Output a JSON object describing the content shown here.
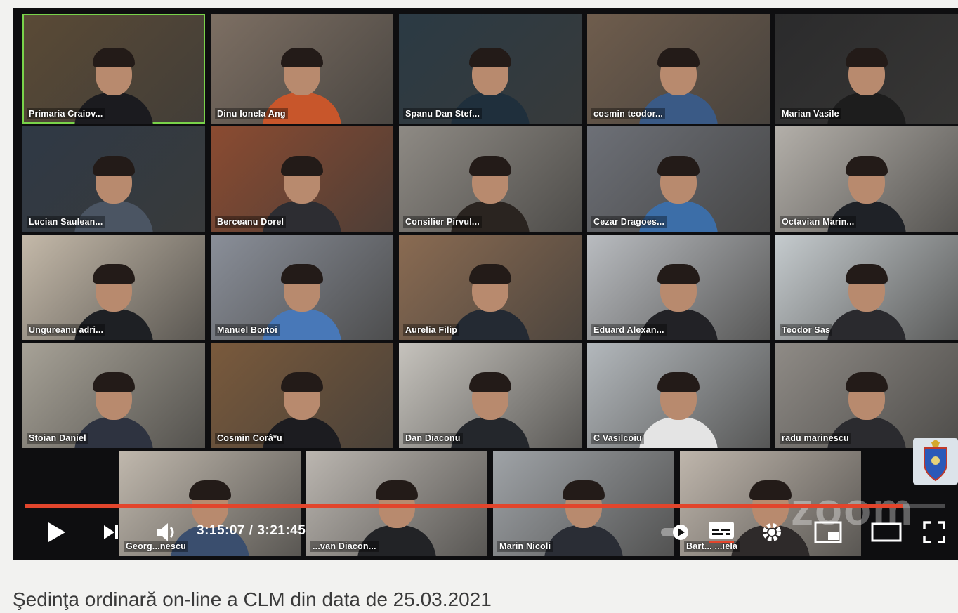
{
  "player": {
    "time_display": "3:15:07 / 3:21:45",
    "progress_fraction": 0.954,
    "watermark": "zoom",
    "accent_color": "#e2452c",
    "active_speaker_color": "#79d34a"
  },
  "participants": [
    {
      "name": "Primaria Craiov...",
      "active": true,
      "bg": "#5a4a36",
      "shirt": "#1b1b1f"
    },
    {
      "name": "Dinu Ionela Ang",
      "active": false,
      "bg": "#7d6f63",
      "shirt": "#c8562b"
    },
    {
      "name": "Spanu Dan Stef...",
      "active": false,
      "bg": "#2b3a44",
      "shirt": "#1f2f3c"
    },
    {
      "name": "cosmin teodor...",
      "active": false,
      "bg": "#6f5d4d",
      "shirt": "#3a5a86"
    },
    {
      "name": "Marian Vasile",
      "active": false,
      "bg": "#2b2b2c",
      "shirt": "#1d1d1d"
    },
    {
      "name": "Lucian Saulean...",
      "active": false,
      "bg": "#2f3945",
      "shirt": "#4b5563"
    },
    {
      "name": "Berceanu Dorel",
      "active": false,
      "bg": "#8b4b31",
      "shirt": "#2d2d32"
    },
    {
      "name": "Consilier Pirvul...",
      "active": false,
      "bg": "#8e8a84",
      "shirt": "#2a2420"
    },
    {
      "name": "Cezar Dragoes...",
      "active": false,
      "bg": "#6d7077",
      "shirt": "#3c6ea8"
    },
    {
      "name": "Octavian Marin...",
      "active": false,
      "bg": "#b3afa9",
      "shirt": "#1f2227"
    },
    {
      "name": "Ungureanu adri...",
      "active": false,
      "bg": "#c4b9a9",
      "shirt": "#1e2024"
    },
    {
      "name": "Manuel Bortoi",
      "active": false,
      "bg": "#8a8f99",
      "shirt": "#4878b8"
    },
    {
      "name": "Aurelia Filip",
      "active": false,
      "bg": "#8a6b52",
      "shirt": "#242a33"
    },
    {
      "name": "Eduard Alexan...",
      "active": false,
      "bg": "#b9bcc0",
      "shirt": "#222226"
    },
    {
      "name": "Teodor Sas",
      "active": false,
      "bg": "#c5cbce",
      "shirt": "#2a2a2e"
    },
    {
      "name": "Stoian Daniel",
      "active": false,
      "bg": "#a7a297",
      "shirt": "#2e3340"
    },
    {
      "name": "Cosmin Corâ*u",
      "active": false,
      "bg": "#7a5a3c",
      "shirt": "#1c1c20"
    },
    {
      "name": "Dan Diaconu",
      "active": false,
      "bg": "#c6c3bd",
      "shirt": "#24272c"
    },
    {
      "name": "C Vasilcoiu",
      "active": false,
      "bg": "#b3b8bc",
      "shirt": "#e4e4e4"
    },
    {
      "name": "radu marinescu",
      "active": false,
      "bg": "#8f8b86",
      "shirt": "#2b2b2f"
    },
    {
      "name": "Georg...nescu",
      "active": false,
      "bg": "#c0b8ad",
      "shirt": "#3a4e6e"
    },
    {
      "name": "...van Diacon...",
      "active": false,
      "bg": "#bbb6b0",
      "shirt": "#222326"
    },
    {
      "name": "Marin Nicoli",
      "active": false,
      "bg": "#9fa3a7",
      "shirt": "#2a2d35"
    },
    {
      "name": "Bart... ...iela",
      "active": false,
      "bg": "#bfb6ac",
      "shirt": "#2e2a2a"
    }
  ],
  "video_title": "Şedinţa ordinară on-line a CLM din data de 25.03.2021"
}
